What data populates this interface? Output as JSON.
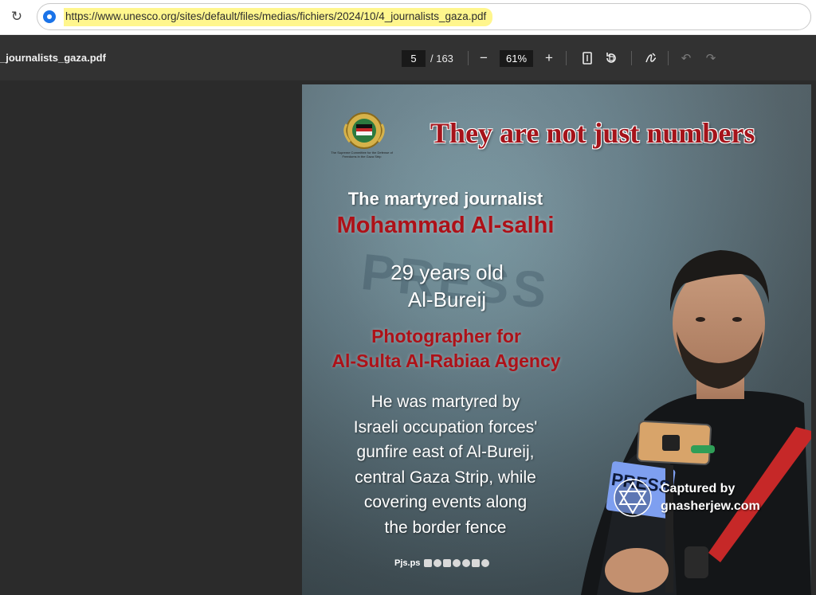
{
  "browser": {
    "url": "https://www.unesco.org/sites/default/files/medias/fichiers/2024/10/4_journalists_gaza.pdf",
    "reload_icon": "reload-icon",
    "site_icon": "site-info-icon"
  },
  "pdf_toolbar": {
    "doc_title": "_journalists_gaza.pdf",
    "page_current": "5",
    "page_total": "/ 163",
    "zoom_value": "61%",
    "zoom_out_glyph": "−",
    "zoom_in_glyph": "+",
    "icons": [
      "fit-page-icon",
      "rotate-icon",
      "annotate-icon",
      "undo-icon",
      "redo-icon"
    ]
  },
  "document": {
    "headline": "They are not just numbers",
    "emblem_caption": "The Supreme Committee for the Defense of Freedoms in the Gaza Strip",
    "label": "The martyred journalist",
    "name": "Mohammad Al-salhi",
    "age": "29 years old",
    "location": "Al-Bureij",
    "job_line1": "Photographer for",
    "job_line2": "Al-Sulta Al-Rabiaa Agency",
    "story": "He was martyred by\nIsraeli occupation forces'\ngunfire east of Al-Bureij,\ncentral Gaza Strip, while\ncovering events along\nthe border fence",
    "footer_brand": "Pjs.ps",
    "vest_text": "PRESS",
    "background_text": "PRESS"
  },
  "watermark": {
    "line1": "Captured by",
    "line2": "gnasherjew.com",
    "icon": "star-of-david-icon"
  },
  "colors": {
    "headline_red": "#a5131a",
    "accent_red": "#ad1118",
    "url_highlight": "#fff68d",
    "toolbar_bg": "#323232",
    "viewer_bg": "#2b2b2b"
  }
}
